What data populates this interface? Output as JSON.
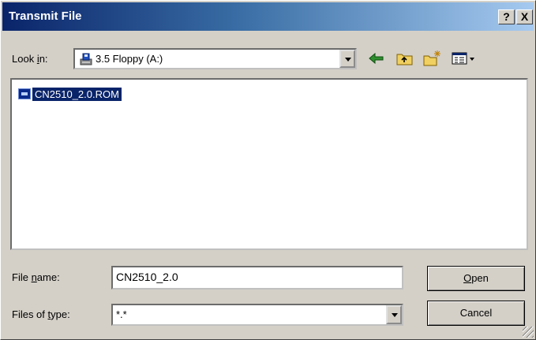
{
  "window": {
    "title": "Transmit File",
    "help_btn": "?",
    "close_btn": "X"
  },
  "lookin": {
    "label_pre": "Look ",
    "label_key": "i",
    "label_post": "n:",
    "value": "3.5 Floppy (A:)"
  },
  "toolbar": {
    "icons": [
      "back-arrow-icon",
      "up-folder-icon",
      "new-folder-icon",
      "view-menu-icon"
    ]
  },
  "files": [
    {
      "name": "CN2510_2.0.ROM",
      "icon": "rom-file-icon",
      "selected": true
    }
  ],
  "filename": {
    "label_pre": "File ",
    "label_key": "n",
    "label_post": "ame:",
    "value": "CN2510_2.0"
  },
  "filetype": {
    "label_pre": "Files of ",
    "label_key": "t",
    "label_post": "ype:",
    "value": "*.*"
  },
  "buttons": {
    "open_key": "O",
    "open_rest": "pen",
    "cancel": "Cancel"
  },
  "colors": {
    "title_bar": "#0a246a",
    "face": "#d4d0c8",
    "selection": "#0a246a"
  }
}
